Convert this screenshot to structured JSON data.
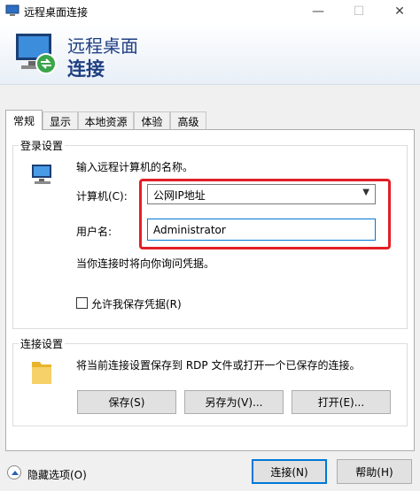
{
  "window": {
    "title": "远程桌面连接"
  },
  "banner": {
    "line1": "远程桌面",
    "line2": "连接"
  },
  "tabs": [
    {
      "label": "常规",
      "active": true
    },
    {
      "label": "显示"
    },
    {
      "label": "本地资源"
    },
    {
      "label": "体验"
    },
    {
      "label": "高级"
    }
  ],
  "login": {
    "group_label": "登录设置",
    "hint": "输入远程计算机的名称。",
    "computer_label": "计算机(C):",
    "computer_value": "公网IP地址",
    "user_label": "用户名:",
    "user_value": "Administrator",
    "note": "当你连接时将向你询问凭据。",
    "allow_save_label": "允许我保存凭据(R)",
    "allow_save_checked": false
  },
  "connection": {
    "group_label": "连接设置",
    "hint": "将当前连接设置保存到 RDP 文件或打开一个已保存的连接。",
    "save_label": "保存(S)",
    "save_as_label": "另存为(V)...",
    "open_label": "打开(E)..."
  },
  "footer": {
    "hide_options_label": "隐藏选项(O)",
    "connect_label": "连接(N)",
    "help_label": "帮助(H)"
  },
  "colors": {
    "accent": "#0078d7",
    "highlight": "#e21f26",
    "banner_text": "#1e3f83"
  }
}
